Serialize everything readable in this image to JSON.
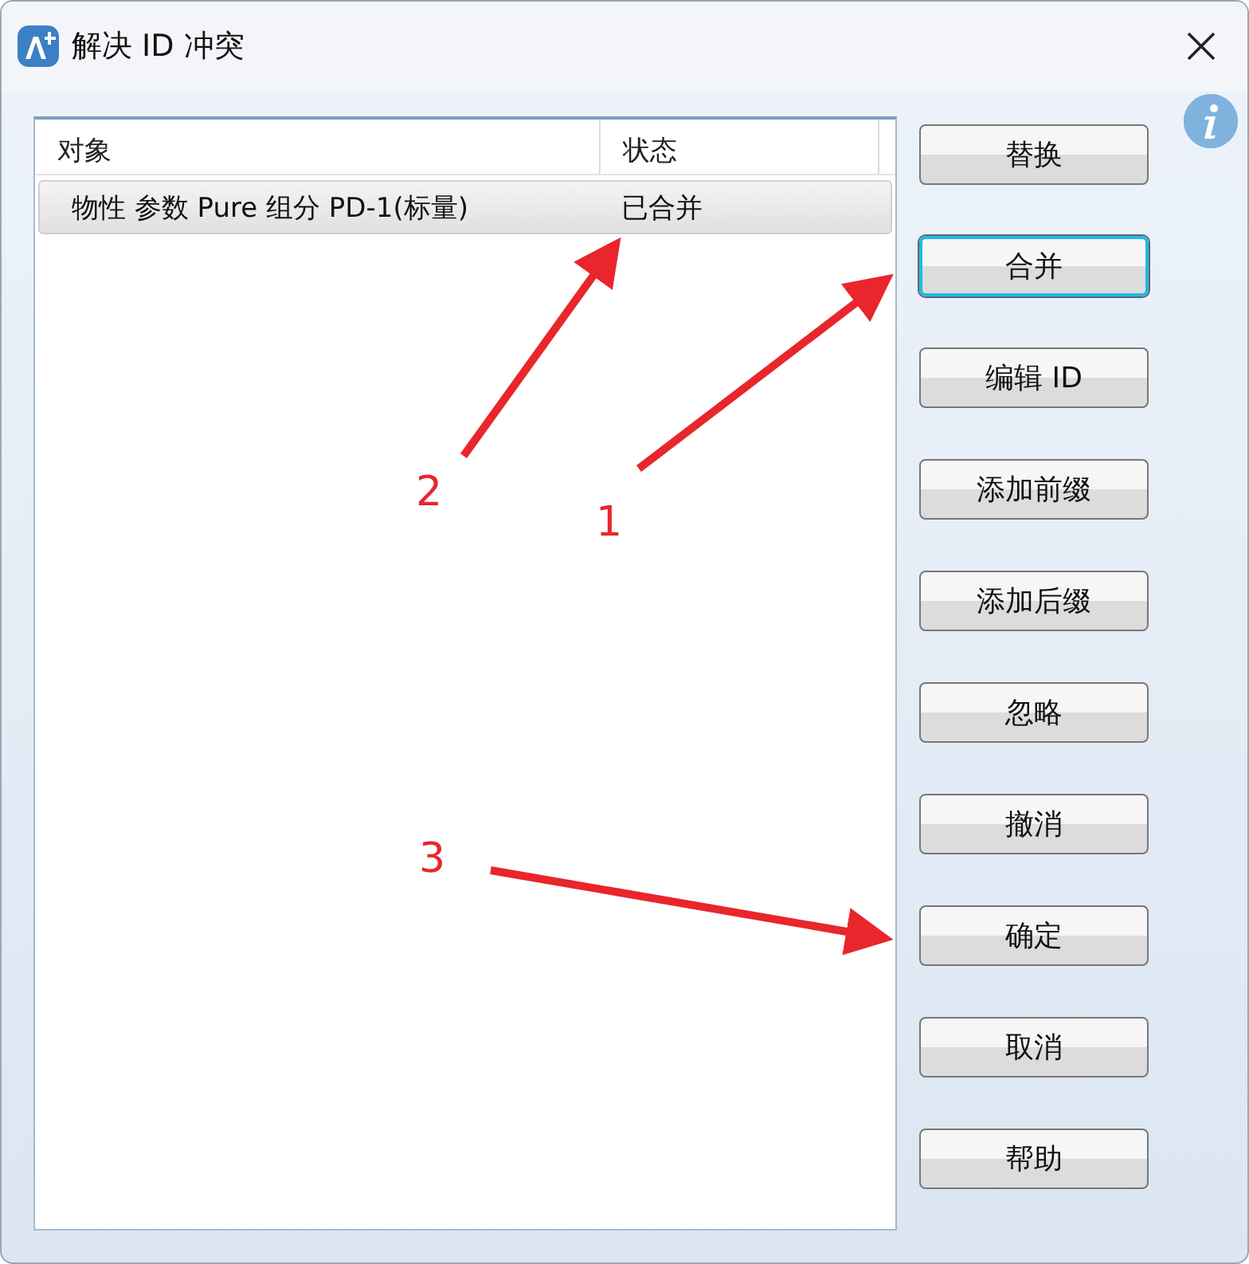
{
  "window": {
    "title": "解决 ID 冲突"
  },
  "table": {
    "columns": [
      "对象",
      "状态"
    ],
    "rows": [
      {
        "cells": [
          "物性 参数 Pure 组分 PD-1(标量)",
          "已合并"
        ],
        "selected": true
      }
    ]
  },
  "buttons": [
    {
      "label": "替换",
      "focused": false
    },
    {
      "label": "合并",
      "focused": true
    },
    {
      "label": "编辑 ID",
      "focused": false
    },
    {
      "label": "添加前缀",
      "focused": false
    },
    {
      "label": "添加后缀",
      "focused": false
    },
    {
      "label": "忽略",
      "focused": false
    },
    {
      "label": "撤消",
      "focused": false
    },
    {
      "label": "确定",
      "focused": false
    },
    {
      "label": "取消",
      "focused": false
    },
    {
      "label": "帮助",
      "focused": false
    }
  ],
  "annotations": [
    {
      "label": "1"
    },
    {
      "label": "2"
    },
    {
      "label": "3"
    }
  ]
}
